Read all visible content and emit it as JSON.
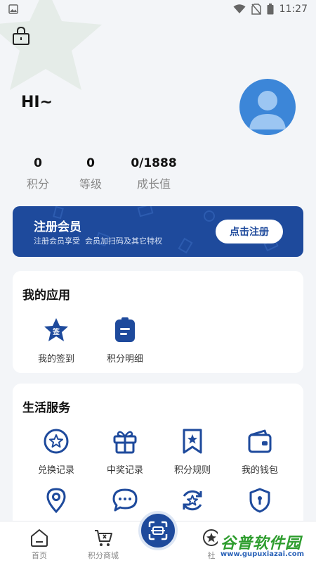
{
  "status_bar": {
    "time": "11:27"
  },
  "profile": {
    "greeting": "HI~"
  },
  "stats": [
    {
      "value": "0",
      "label": "积分"
    },
    {
      "value": "0",
      "label": "等级"
    },
    {
      "value": "0/1888",
      "label": "成长值"
    }
  ],
  "member": {
    "title": "注册会员",
    "subtitle": "注册会员享受  会员加扫码及其它特权",
    "button": "点击注册"
  },
  "my_apps": {
    "title": "我的应用",
    "items": [
      {
        "label": "我的签到",
        "icon": "sign-in-star-icon"
      },
      {
        "label": "积分明细",
        "icon": "clipboard-list-icon"
      }
    ]
  },
  "life_services": {
    "title": "生活服务",
    "items": [
      {
        "label": "兑换记录",
        "icon": "star-circle-icon"
      },
      {
        "label": "中奖记录",
        "icon": "gift-icon"
      },
      {
        "label": "积分规则",
        "icon": "bookmark-star-icon"
      },
      {
        "label": "我的钱包",
        "icon": "wallet-icon"
      },
      {
        "label": "",
        "icon": "location-pin-icon"
      },
      {
        "label": "",
        "icon": "chat-bubble-icon"
      },
      {
        "label": "",
        "icon": "refresh-star-icon"
      },
      {
        "label": "",
        "icon": "shield-lock-icon"
      }
    ]
  },
  "bottom_nav": {
    "items": [
      {
        "label": "首页",
        "icon": "home-icon"
      },
      {
        "label": "积分商城",
        "icon": "cart-icon"
      },
      {
        "label": "社",
        "icon": "star-circle-icon"
      }
    ],
    "scan_icon": "scan-icon"
  },
  "watermark": {
    "main": "谷普软件园",
    "url": "www.gupuxiazai.com"
  },
  "colors": {
    "primary": "#1e4a9c",
    "avatar": "#3c86d8",
    "background": "#f3f5f8"
  }
}
